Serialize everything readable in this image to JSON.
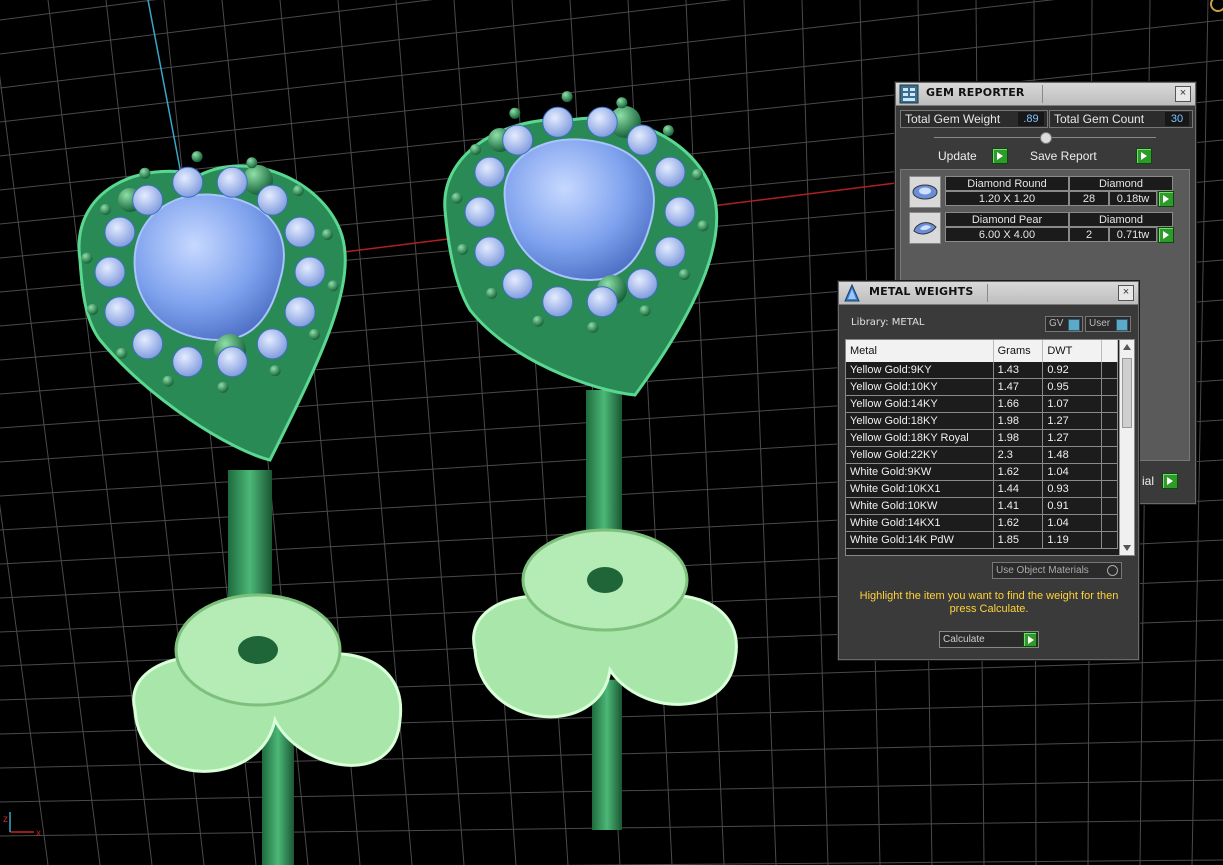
{
  "gem_reporter": {
    "title": "GEM REPORTER",
    "close": "×",
    "total_weight_label": "Total Gem Weight",
    "total_weight_value": ".89",
    "total_count_label": "Total Gem Count",
    "total_count_value": "30",
    "update_label": "Update",
    "save_label": "Save Report",
    "partial_label": "ial",
    "gems": [
      {
        "name": "Diamond Round",
        "type": "Diamond",
        "size": "1.20 X 1.20",
        "count": "28",
        "weight": "0.18tw"
      },
      {
        "name": "Diamond Pear",
        "type": "Diamond",
        "size": "6.00 X 4.00",
        "count": "2",
        "weight": "0.71tw"
      }
    ]
  },
  "metal_weights": {
    "title": "METAL WEIGHTS",
    "close": "×",
    "library": "Library: METAL",
    "gv_label": "GV",
    "user_label": "User",
    "columns": [
      "Metal",
      "Grams",
      "DWT"
    ],
    "rows": [
      [
        "Yellow Gold:9KY",
        "1.43",
        "0.92"
      ],
      [
        "Yellow Gold:10KY",
        "1.47",
        "0.95"
      ],
      [
        "Yellow Gold:14KY",
        "1.66",
        "1.07"
      ],
      [
        "Yellow Gold:18KY",
        "1.98",
        "1.27"
      ],
      [
        "Yellow Gold:18KY Royal",
        "1.98",
        "1.27"
      ],
      [
        "Yellow Gold:22KY",
        "2.3",
        "1.48"
      ],
      [
        "White Gold:9KW",
        "1.62",
        "1.04"
      ],
      [
        "White Gold:10KX1",
        "1.44",
        "0.93"
      ],
      [
        "White Gold:10KW",
        "1.41",
        "0.91"
      ],
      [
        "White Gold:14KX1",
        "1.62",
        "1.04"
      ],
      [
        "White Gold:14K PdW",
        "1.85",
        "1.19"
      ]
    ],
    "use_object_materials": "Use Object Materials",
    "hint": "Highlight the item you want to find the weight for then press Calculate.",
    "calculate_label": "Calculate"
  },
  "axis": {
    "x_label": "x",
    "y_label": "z"
  },
  "colors": {
    "grid": "#4a4a4a",
    "metal": "#2f8a55",
    "backing": "#a8e2a8",
    "gem": "#8fb3ff",
    "hint": "#ffd23a"
  }
}
